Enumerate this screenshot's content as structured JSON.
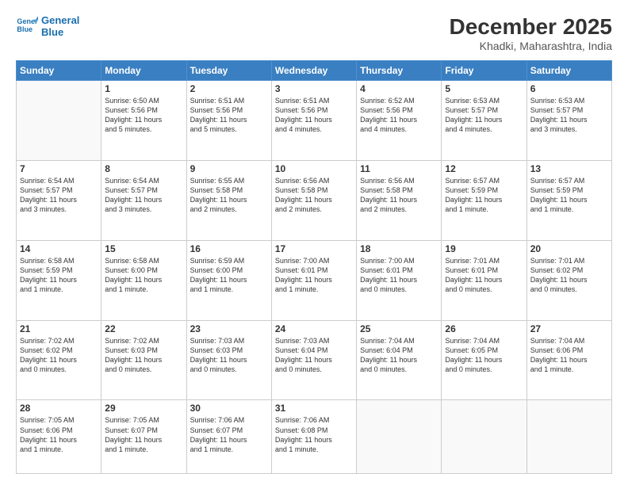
{
  "logo": {
    "line1": "General",
    "line2": "Blue"
  },
  "title": "December 2025",
  "subtitle": "Khadki, Maharashtra, India",
  "days_of_week": [
    "Sunday",
    "Monday",
    "Tuesday",
    "Wednesday",
    "Thursday",
    "Friday",
    "Saturday"
  ],
  "weeks": [
    [
      {
        "num": "",
        "info": ""
      },
      {
        "num": "1",
        "info": "Sunrise: 6:50 AM\nSunset: 5:56 PM\nDaylight: 11 hours\nand 5 minutes."
      },
      {
        "num": "2",
        "info": "Sunrise: 6:51 AM\nSunset: 5:56 PM\nDaylight: 11 hours\nand 5 minutes."
      },
      {
        "num": "3",
        "info": "Sunrise: 6:51 AM\nSunset: 5:56 PM\nDaylight: 11 hours\nand 4 minutes."
      },
      {
        "num": "4",
        "info": "Sunrise: 6:52 AM\nSunset: 5:56 PM\nDaylight: 11 hours\nand 4 minutes."
      },
      {
        "num": "5",
        "info": "Sunrise: 6:53 AM\nSunset: 5:57 PM\nDaylight: 11 hours\nand 4 minutes."
      },
      {
        "num": "6",
        "info": "Sunrise: 6:53 AM\nSunset: 5:57 PM\nDaylight: 11 hours\nand 3 minutes."
      }
    ],
    [
      {
        "num": "7",
        "info": "Sunrise: 6:54 AM\nSunset: 5:57 PM\nDaylight: 11 hours\nand 3 minutes."
      },
      {
        "num": "8",
        "info": "Sunrise: 6:54 AM\nSunset: 5:57 PM\nDaylight: 11 hours\nand 3 minutes."
      },
      {
        "num": "9",
        "info": "Sunrise: 6:55 AM\nSunset: 5:58 PM\nDaylight: 11 hours\nand 2 minutes."
      },
      {
        "num": "10",
        "info": "Sunrise: 6:56 AM\nSunset: 5:58 PM\nDaylight: 11 hours\nand 2 minutes."
      },
      {
        "num": "11",
        "info": "Sunrise: 6:56 AM\nSunset: 5:58 PM\nDaylight: 11 hours\nand 2 minutes."
      },
      {
        "num": "12",
        "info": "Sunrise: 6:57 AM\nSunset: 5:59 PM\nDaylight: 11 hours\nand 1 minute."
      },
      {
        "num": "13",
        "info": "Sunrise: 6:57 AM\nSunset: 5:59 PM\nDaylight: 11 hours\nand 1 minute."
      }
    ],
    [
      {
        "num": "14",
        "info": "Sunrise: 6:58 AM\nSunset: 5:59 PM\nDaylight: 11 hours\nand 1 minute."
      },
      {
        "num": "15",
        "info": "Sunrise: 6:58 AM\nSunset: 6:00 PM\nDaylight: 11 hours\nand 1 minute."
      },
      {
        "num": "16",
        "info": "Sunrise: 6:59 AM\nSunset: 6:00 PM\nDaylight: 11 hours\nand 1 minute."
      },
      {
        "num": "17",
        "info": "Sunrise: 7:00 AM\nSunset: 6:01 PM\nDaylight: 11 hours\nand 1 minute."
      },
      {
        "num": "18",
        "info": "Sunrise: 7:00 AM\nSunset: 6:01 PM\nDaylight: 11 hours\nand 0 minutes."
      },
      {
        "num": "19",
        "info": "Sunrise: 7:01 AM\nSunset: 6:01 PM\nDaylight: 11 hours\nand 0 minutes."
      },
      {
        "num": "20",
        "info": "Sunrise: 7:01 AM\nSunset: 6:02 PM\nDaylight: 11 hours\nand 0 minutes."
      }
    ],
    [
      {
        "num": "21",
        "info": "Sunrise: 7:02 AM\nSunset: 6:02 PM\nDaylight: 11 hours\nand 0 minutes."
      },
      {
        "num": "22",
        "info": "Sunrise: 7:02 AM\nSunset: 6:03 PM\nDaylight: 11 hours\nand 0 minutes."
      },
      {
        "num": "23",
        "info": "Sunrise: 7:03 AM\nSunset: 6:03 PM\nDaylight: 11 hours\nand 0 minutes."
      },
      {
        "num": "24",
        "info": "Sunrise: 7:03 AM\nSunset: 6:04 PM\nDaylight: 11 hours\nand 0 minutes."
      },
      {
        "num": "25",
        "info": "Sunrise: 7:04 AM\nSunset: 6:04 PM\nDaylight: 11 hours\nand 0 minutes."
      },
      {
        "num": "26",
        "info": "Sunrise: 7:04 AM\nSunset: 6:05 PM\nDaylight: 11 hours\nand 0 minutes."
      },
      {
        "num": "27",
        "info": "Sunrise: 7:04 AM\nSunset: 6:06 PM\nDaylight: 11 hours\nand 1 minute."
      }
    ],
    [
      {
        "num": "28",
        "info": "Sunrise: 7:05 AM\nSunset: 6:06 PM\nDaylight: 11 hours\nand 1 minute."
      },
      {
        "num": "29",
        "info": "Sunrise: 7:05 AM\nSunset: 6:07 PM\nDaylight: 11 hours\nand 1 minute."
      },
      {
        "num": "30",
        "info": "Sunrise: 7:06 AM\nSunset: 6:07 PM\nDaylight: 11 hours\nand 1 minute."
      },
      {
        "num": "31",
        "info": "Sunrise: 7:06 AM\nSunset: 6:08 PM\nDaylight: 11 hours\nand 1 minute."
      },
      {
        "num": "",
        "info": ""
      },
      {
        "num": "",
        "info": ""
      },
      {
        "num": "",
        "info": ""
      }
    ]
  ]
}
